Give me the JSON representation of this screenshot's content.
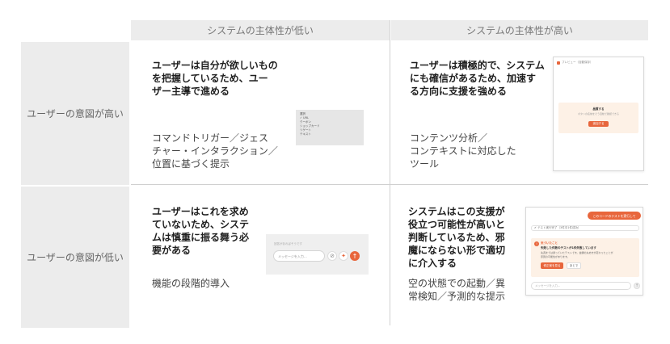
{
  "headers": {
    "col_low": "システムの主体性が低い",
    "col_high": "システムの主体性が高い"
  },
  "rows": {
    "high_intent": "ユーザーの意図が高い",
    "low_intent": "ユーザーの意図が低い"
  },
  "cells": {
    "q1": {
      "title": "ユーザーは自分が欲しいものを把握しているため、ユーザー主導で進める",
      "title_lines": [
        "ユーザーは自分が欲しいもの",
        "を把握しているため、ユー",
        "ザー主導で進める"
      ],
      "desc_lines": [
        "コマンドトリガー／ジェス",
        "チャー・インタラクション／",
        "位置に基づく提示"
      ]
    },
    "q2": {
      "title_lines": [
        "ユーザーは積極的で、システム",
        "にも確信があるため、加速す",
        "る方向に支援を強める"
      ],
      "desc_lines": [
        "コンテンツ分析／",
        "コンテキストに対応した",
        "ツール"
      ]
    },
    "q3": {
      "title_lines": [
        "ユーザーはこれを求め",
        "ていないため、システ",
        "ムは慎重に振る舞う必",
        "要がある"
      ],
      "desc_lines": [
        "機能の段階的導入"
      ]
    },
    "q4": {
      "title_lines": [
        "システムはこの支援が",
        "役立つ可能性が高いと",
        "判断しているため、邪",
        "魔にならない形で適切",
        "に介入する"
      ],
      "desc_lines": [
        "空の状態での起動／異",
        "常検知／予測的な提示"
      ]
    }
  },
  "mock_menu": {
    "items": [
      "選択",
      "✓ URL",
      "クーポン",
      "ショップカード",
      "リゲート",
      "テキスト"
    ]
  },
  "mock_preview": {
    "header": "プレビュー（自動保存）",
    "box_title": "品質する",
    "box_sub": "ボタンの名前をそう自動で確認できる",
    "box_button": "追加する"
  },
  "mock_chat_input": {
    "hint": "回答があればそうです",
    "placeholder": "メッセージを入力...",
    "send_icon": "arrow-up-icon"
  },
  "mock_alert": {
    "top_button": "このコードのテストを実行して",
    "status": "テスト実行完了（3件中1件成功）",
    "alert_title": "気づいたこと",
    "alert_heading": "失敗した件数のテストが1件失敗しています",
    "alert_body1": "先週までは通っていたテストです。金額の丸め方が変わったことが",
    "alert_body2": "原因の可能性があります。",
    "fix_button": "修正案を見る",
    "later_button": "あとで",
    "input_placeholder": "メッセージを入力..."
  },
  "colors": {
    "accent": "#e8663c",
    "header_bg": "#ececec",
    "alert_bg": "#fdf1e6"
  }
}
